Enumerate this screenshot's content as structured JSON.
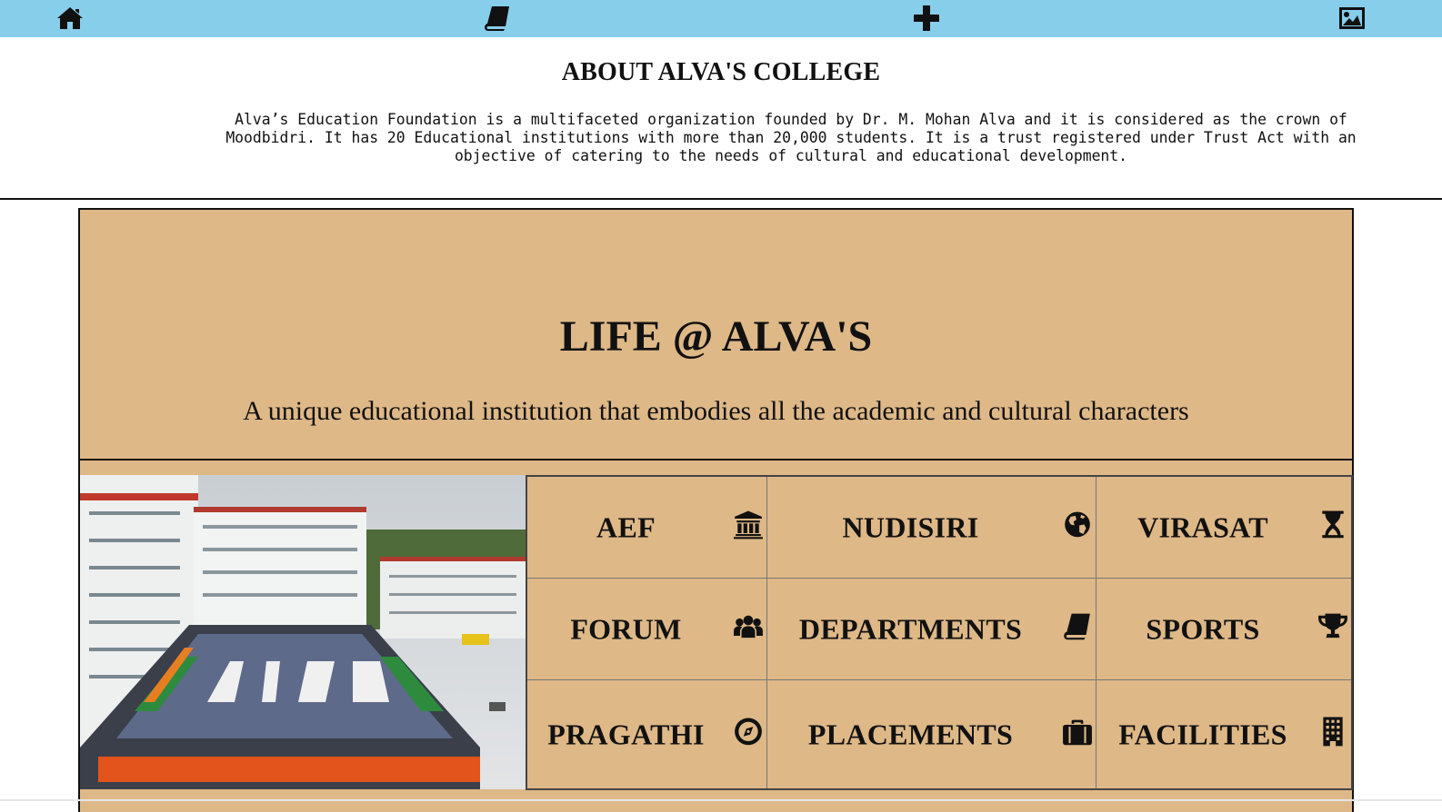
{
  "nav": {
    "icons": [
      "home-icon",
      "book-icon",
      "plus-icon",
      "image-icon"
    ],
    "bar_color": "#87ceeb"
  },
  "about": {
    "title": "ABOUT ALVA'S COLLEGE",
    "text": "Alva’s Education Foundation is a multifaceted organization founded by Dr. M. Mohan Alva and it is considered as the crown of Moodbidri. It has 20 Educational institutions with more than 20,000 students. It is a trust registered under Trust Act with an objective of catering to the needs of cultural and educational development."
  },
  "life": {
    "title": "LIFE @ ALVA'S",
    "subtitle": "A unique educational institution that embodies all the academic and cultural characters",
    "panel_color": "#deb887"
  },
  "grid": {
    "items": [
      {
        "label": "AEF",
        "icon": "university-icon"
      },
      {
        "label": "NUDISIRI",
        "icon": "globe-icon"
      },
      {
        "label": "VIRASAT",
        "icon": "hourglass-icon"
      },
      {
        "label": "FORUM",
        "icon": "users-icon"
      },
      {
        "label": "DEPARTMENTS",
        "icon": "book-icon"
      },
      {
        "label": "SPORTS",
        "icon": "trophy-icon"
      },
      {
        "label": "PRAGATHI",
        "icon": "compass-icon"
      },
      {
        "label": "PLACEMENTS",
        "icon": "briefcase-icon"
      },
      {
        "label": "FACILITIES",
        "icon": "building-icon"
      }
    ]
  }
}
